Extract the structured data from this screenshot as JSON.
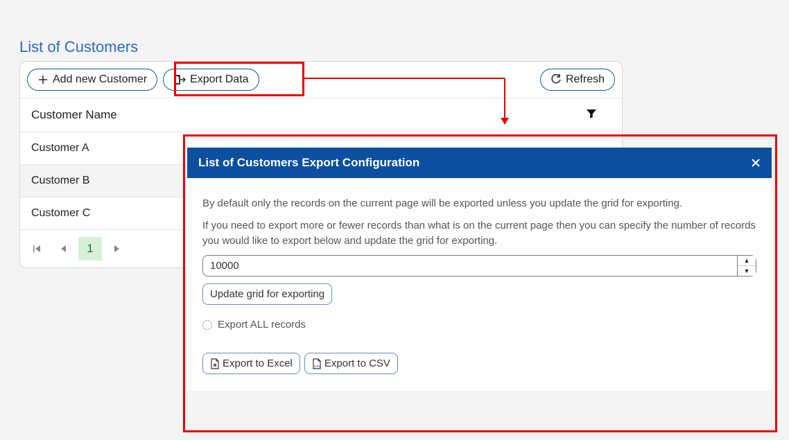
{
  "panel": {
    "title": "List of Customers",
    "add_button": "Add new Customer",
    "export_button": "Export Data",
    "refresh_button": "Refresh"
  },
  "grid": {
    "column_header": "Customer Name",
    "rows": [
      {
        "name": "Customer A"
      },
      {
        "name": "Customer B"
      },
      {
        "name": "Customer C"
      }
    ]
  },
  "pager": {
    "current_page": "1"
  },
  "dialog": {
    "title": "List of Customers Export Configuration",
    "desc1": "By default only the records on the current page will be exported unless you update the grid for exporting.",
    "desc2": "If you need to export more or fewer records than what is on the current page then you can specify the number of records you would like to export below and update the grid for exporting.",
    "count_value": "10000",
    "update_button": "Update grid for exporting",
    "export_all_label": "Export ALL records",
    "export_excel": "Export to Excel",
    "export_csv": "Export to CSV"
  },
  "icons": {
    "plus": "plus-icon",
    "export": "export-icon",
    "refresh": "refresh-icon",
    "filter": "filter-icon",
    "first": "first-page-icon",
    "prev": "prev-page-icon",
    "next": "next-page-icon",
    "close": "close-icon",
    "excel": "excel-file-icon",
    "csv": "csv-file-icon"
  }
}
